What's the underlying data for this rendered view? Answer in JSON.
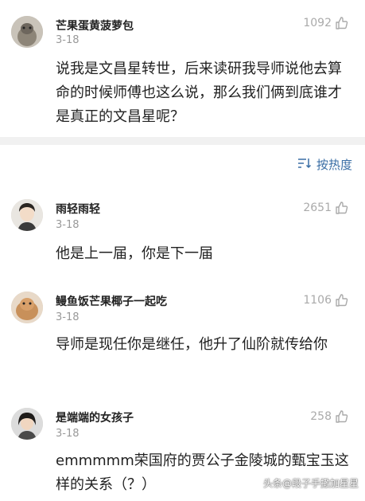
{
  "top_post": {
    "username": "芒果蛋黄菠萝包",
    "date": "3-18",
    "likes": "1092",
    "text": "说我是文昌星转世，后来读研我导师说他去算命的时候师傅也这么说，那么我们俩到底谁才是真正的文昌星呢？"
  },
  "sort": {
    "label": "按热度"
  },
  "replies": [
    {
      "username": "雨轻雨轻",
      "date": "3-18",
      "likes": "2651",
      "text": "他是上一届，你是下一届"
    },
    {
      "username": "鳗鱼饭芒果椰子一起吃",
      "date": "3-18",
      "likes": "1106",
      "text": "导师是现任你是继任，他升了仙阶就传给你"
    },
    {
      "username": "是端端的女孩子",
      "date": "3-18",
      "likes": "258",
      "text": "emmmmm荣国府的贾公子金陵城的甄宝玉这样的关系（？）"
    }
  ],
  "watermark": "头条@段子手撒加星星",
  "icons": {
    "like": "thumbs-up-icon",
    "sort": "sort-icon"
  },
  "colors": {
    "link": "#3a6ea5",
    "meta": "#999999",
    "divider": "#f1f1f1"
  }
}
